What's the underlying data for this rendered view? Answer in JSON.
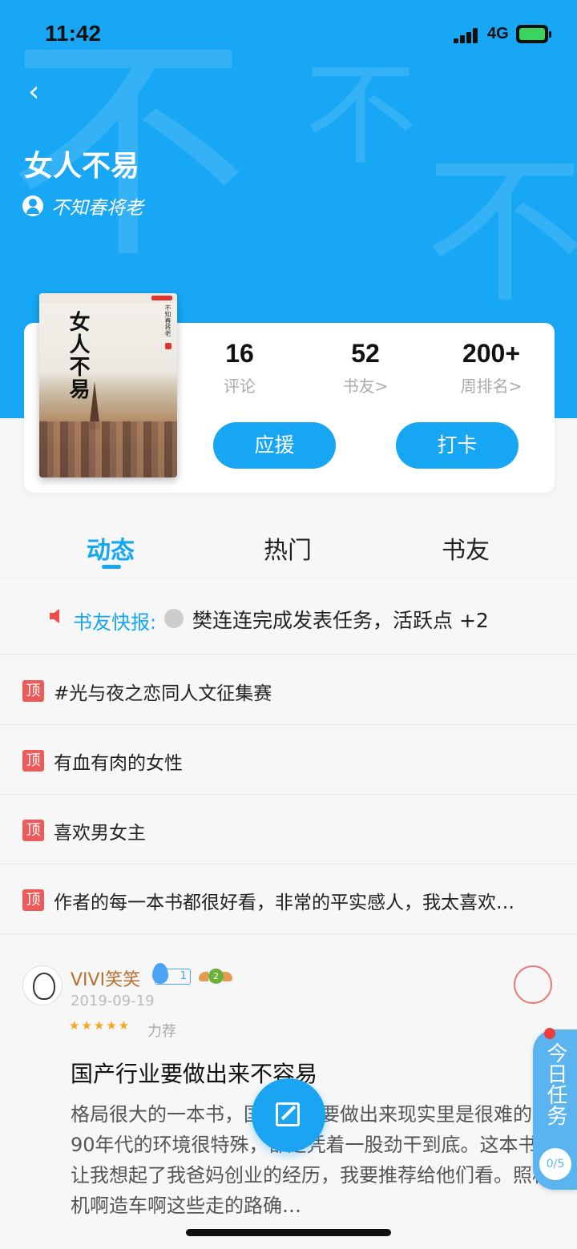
{
  "status_bar": {
    "time": "11:42",
    "network": "4G"
  },
  "header": {
    "book_title": "女人不易",
    "author": "不知春将老",
    "watermark_char": "不"
  },
  "cover": {
    "title": "女人不易",
    "author": "不知春将老"
  },
  "stats": [
    {
      "value": "16",
      "label": "评论"
    },
    {
      "value": "52",
      "label": "书友>"
    },
    {
      "value": "200+",
      "label": "周排名>"
    }
  ],
  "actions": {
    "support": "应援",
    "checkin": "打卡"
  },
  "tabs": [
    {
      "label": "动态",
      "active": true
    },
    {
      "label": "热门",
      "active": false
    },
    {
      "label": "书友",
      "active": false
    }
  ],
  "news": {
    "label": "书友快报:",
    "text": "樊连连完成发表任务，活跃点 +2"
  },
  "pinned_tag": "顶",
  "pinned": [
    "#光与夜之恋同人文征集赛",
    "有血有肉的女性",
    "喜欢男女主",
    "作者的每一本书都很好看，非常的平实感人，我太喜欢…"
  ],
  "post": {
    "username": "VIVI笑笑",
    "level": "1",
    "badge_level": "2",
    "date": "2019-09-19",
    "stars": "★★★★★",
    "tag": "力荐",
    "title": "国产行业要做出来不容易",
    "body": "格局很大的一本书，国产行业要做出来现实里是很难的。90年代的环境很特殊，都是凭着一股劲干到底。这本书让我想起了我爸妈创业的经历，我要推荐给他们看。照相机啊造车啊这些走的路确…"
  },
  "task": {
    "label": "今日任务",
    "count": "0/5"
  },
  "colors": {
    "brand": "#17a7f4",
    "accent_red": "#ec5a5a",
    "username": "#b5702e"
  }
}
